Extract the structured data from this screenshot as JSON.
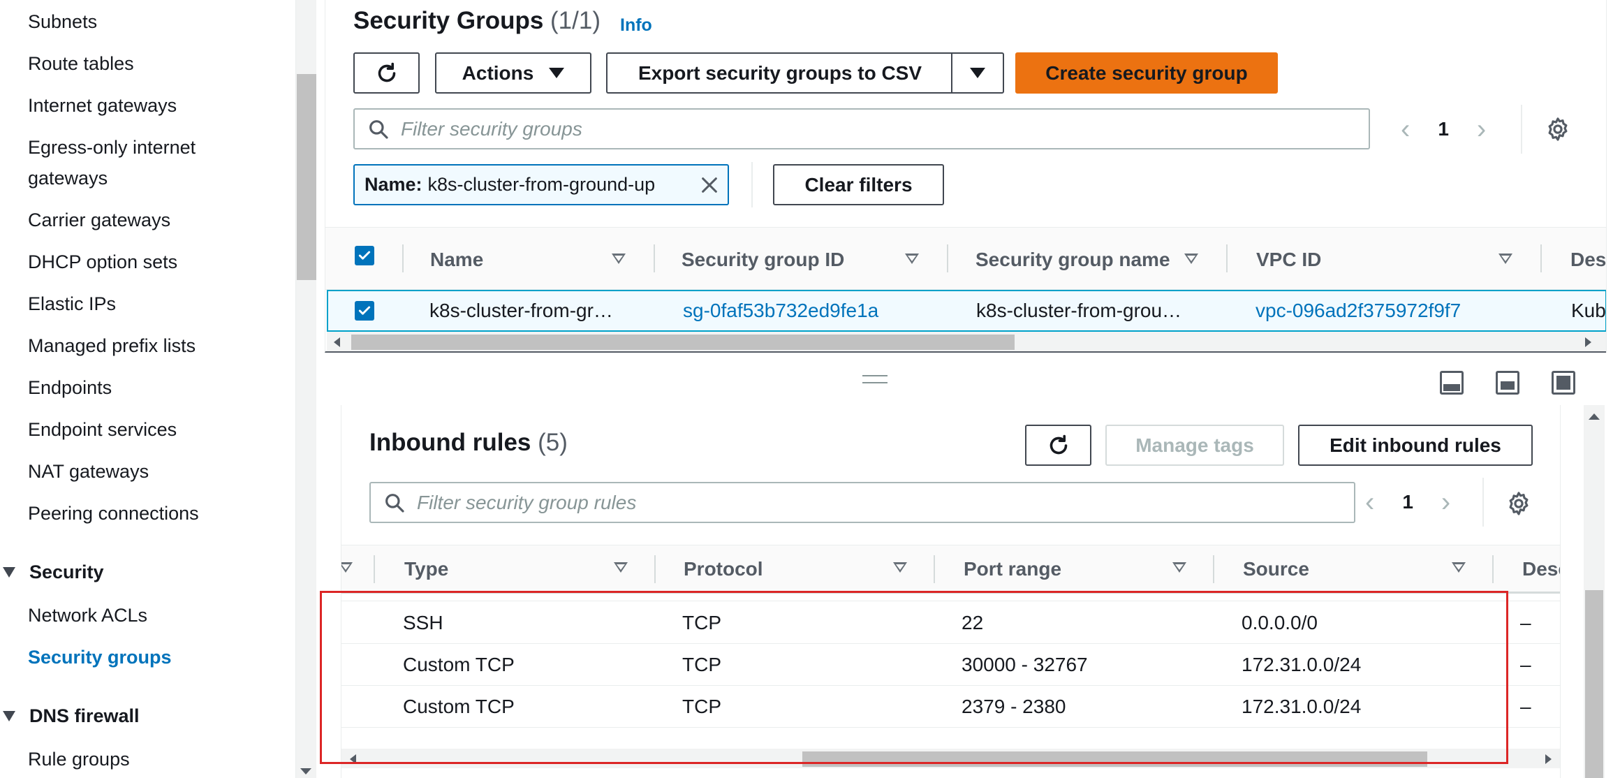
{
  "sidebar": {
    "items": [
      {
        "label": "Subnets"
      },
      {
        "label": "Route tables"
      },
      {
        "label": "Internet gateways"
      },
      {
        "label": "Egress-only internet"
      },
      {
        "label": "gateways"
      },
      {
        "label": "Carrier gateways"
      },
      {
        "label": "DHCP option sets"
      },
      {
        "label": "Elastic IPs"
      },
      {
        "label": "Managed prefix lists"
      },
      {
        "label": "Endpoints"
      },
      {
        "label": "Endpoint services"
      },
      {
        "label": "NAT gateways"
      },
      {
        "label": "Peering connections"
      }
    ],
    "section_security": "Security",
    "security_items": [
      {
        "label": "Network ACLs"
      },
      {
        "label": "Security groups"
      }
    ],
    "section_dns": "DNS firewall",
    "dns_items": [
      {
        "label": "Rule groups"
      }
    ]
  },
  "security_groups": {
    "title": "Security Groups",
    "count": "(1/1)",
    "info": "Info",
    "refresh_icon": "refresh-icon",
    "actions_label": "Actions",
    "export_label": "Export security groups to CSV",
    "create_label": "Create security group",
    "search_placeholder": "Filter security groups",
    "page": "1",
    "filter_token_key": "Name:",
    "filter_token_value": "k8s-cluster-from-ground-up",
    "clear_filters": "Clear filters",
    "columns": [
      "Name",
      "Security group ID",
      "Security group name",
      "VPC ID",
      "Des"
    ],
    "row": {
      "name": "k8s-cluster-from-gr…",
      "sg_id": "sg-0faf53b732ed9fe1a",
      "sg_name": "k8s-cluster-from-grou…",
      "vpc_id": "vpc-096ad2f375972f9f7",
      "description": "Kub"
    }
  },
  "inbound_rules": {
    "title": "Inbound rules",
    "count": "(5)",
    "manage_tags": "Manage tags",
    "edit_inbound": "Edit inbound rules",
    "search_placeholder": "Filter security group rules",
    "page": "1",
    "columns": [
      "Type",
      "Protocol",
      "Port range",
      "Source",
      "Desc"
    ],
    "rows": [
      {
        "type": "SSH",
        "protocol": "TCP",
        "port_range": "22",
        "source": "0.0.0.0/0",
        "description": "–"
      },
      {
        "type": "Custom TCP",
        "protocol": "TCP",
        "port_range": "30000 - 32767",
        "source": "172.31.0.0/24",
        "description": "–"
      },
      {
        "type": "Custom TCP",
        "protocol": "TCP",
        "port_range": "2379 - 2380",
        "source": "172.31.0.0/24",
        "description": "–"
      }
    ]
  },
  "colors": {
    "accent": "#0073bb",
    "primary_button": "#ec7211",
    "highlight": "#dc2626"
  }
}
